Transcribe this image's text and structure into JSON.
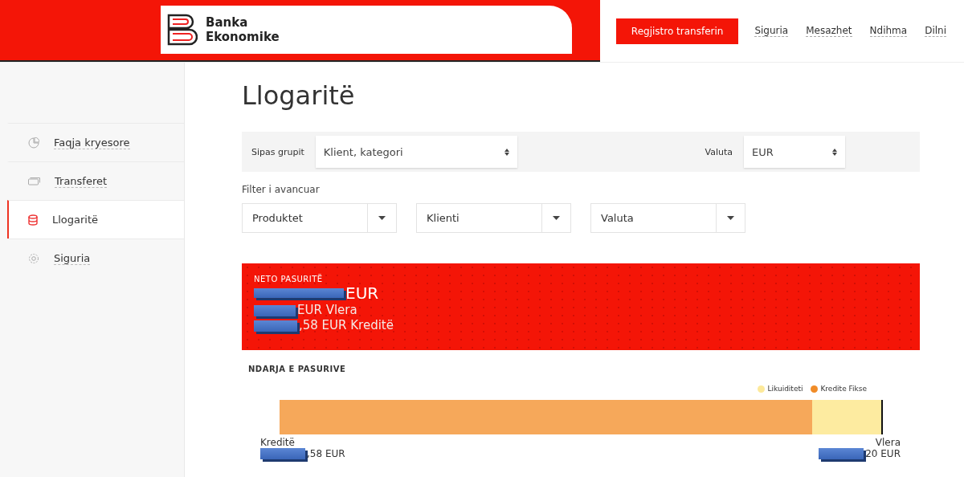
{
  "header": {
    "logo": {
      "line1": "Banka",
      "line2": "Ekonomike"
    },
    "cta": "Regjistro transferin",
    "nav": [
      "Siguria",
      "Mesazhet",
      "Ndihma",
      "Dilni"
    ]
  },
  "sidebar": {
    "items": [
      {
        "label": "Faqja kryesore",
        "selected": false
      },
      {
        "label": "Transferet",
        "selected": false
      },
      {
        "label": "Llogaritë",
        "selected": true
      },
      {
        "label": "Siguria",
        "selected": false
      }
    ]
  },
  "page": {
    "title": "Llogaritë",
    "group_bar": {
      "group_label": "Sipas grupit",
      "group_value": "Klient, kategori",
      "currency_label": "Valuta",
      "currency_value": "EUR"
    },
    "advanced_filter": {
      "title": "Filter i avancuar",
      "dropdowns": [
        "Produktet",
        "Klienti",
        "Valuta"
      ]
    },
    "net_assets": {
      "label": "NETO PASURITË",
      "total": "EUR",
      "lines": [
        "EUR Vlera",
        ",58 EUR Kreditë"
      ]
    },
    "breakdown": {
      "title": "NDARJA E PASURIVE",
      "legend": [
        {
          "label": "Likuiditeti",
          "color": "#fde99a"
        },
        {
          "label": "Kredite Fikse",
          "color": "#f08c28"
        }
      ],
      "segments": [
        {
          "color": "#f6a85a",
          "level": 0.885
        },
        {
          "color": "#fdeba0",
          "level": 0.115
        }
      ],
      "left_label": "Kreditë",
      "left_value": ",58 EUR",
      "right_label": "Vlera",
      "right_value": "20 EUR"
    }
  }
}
